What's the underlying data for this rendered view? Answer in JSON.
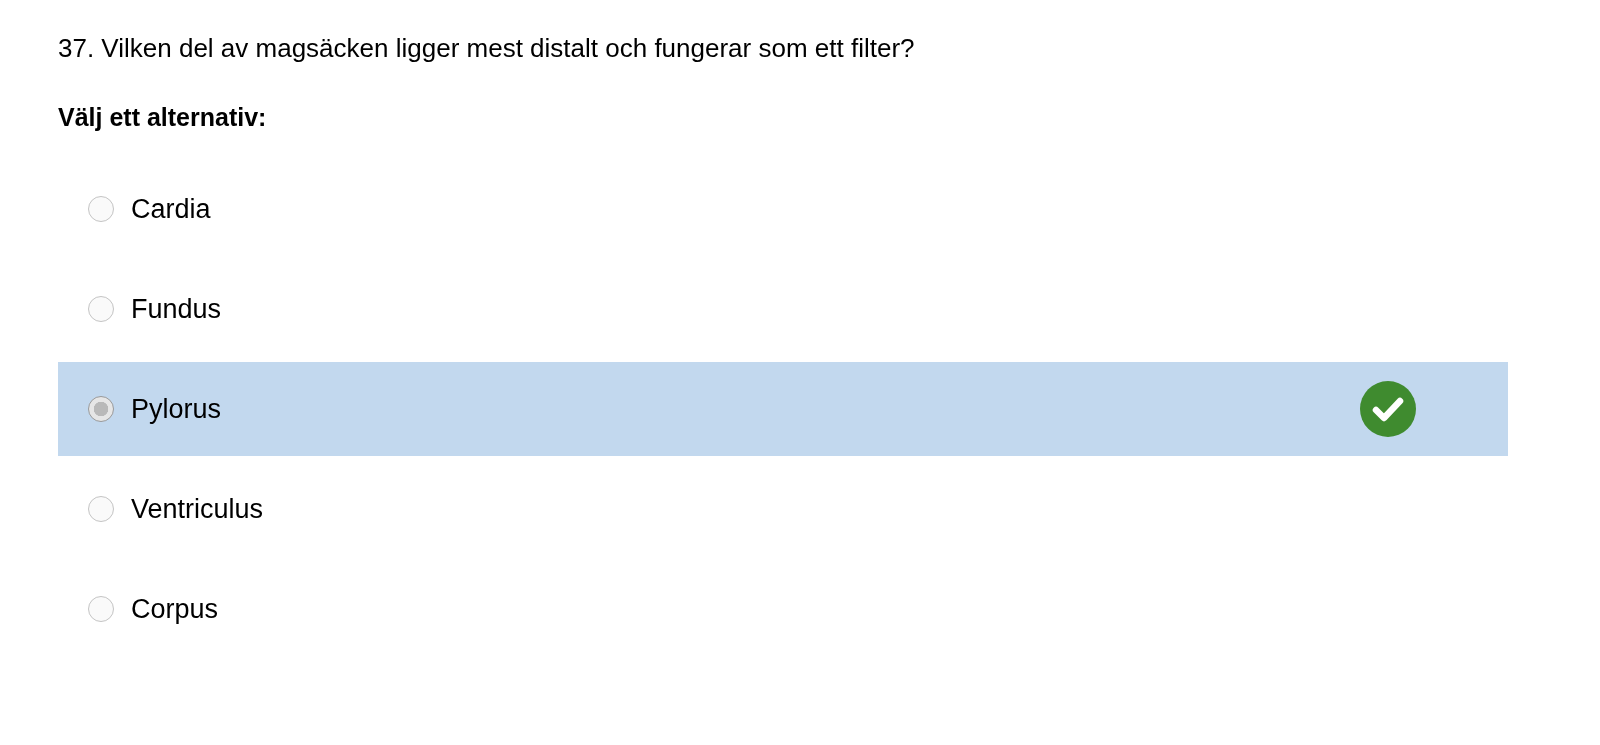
{
  "question": "37. Vilken del av magsäcken ligger mest distalt och fungerar som ett filter?",
  "prompt": "Välj ett alternativ:",
  "options": [
    {
      "label": "Cardia",
      "selected": false,
      "correct": false
    },
    {
      "label": "Fundus",
      "selected": false,
      "correct": false
    },
    {
      "label": "Pylorus",
      "selected": true,
      "correct": true
    },
    {
      "label": "Ventriculus",
      "selected": false,
      "correct": false
    },
    {
      "label": "Corpus",
      "selected": false,
      "correct": false
    }
  ]
}
